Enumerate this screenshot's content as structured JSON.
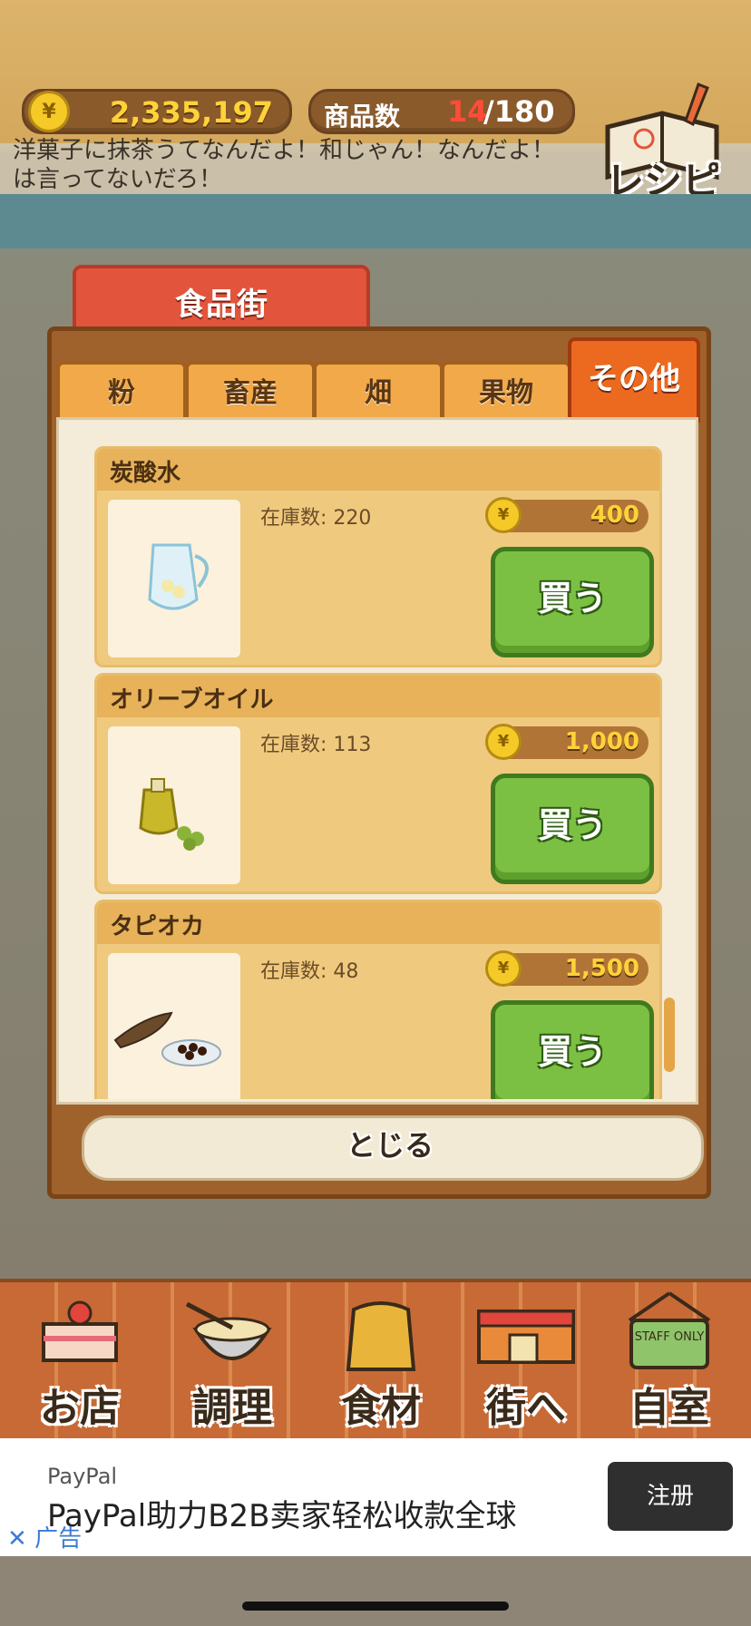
{
  "hud": {
    "coin_icon": "¥",
    "money": "2,335,197",
    "item_count_label": "商品数",
    "item_count_current": "14",
    "item_count_max": "/180",
    "recipe_label": "レシピ"
  },
  "speech": {
    "text": "洋菓子に抹茶うてなんだよ！和じゃん！なんだよ！\nは言ってないだろ！"
  },
  "district": {
    "label": "食品街"
  },
  "tabs": [
    {
      "label": "粉",
      "active": false
    },
    {
      "label": "畜産",
      "active": false
    },
    {
      "label": "畑",
      "active": false
    },
    {
      "label": "果物",
      "active": false
    },
    {
      "label": "その他",
      "active": true
    }
  ],
  "products": [
    {
      "name": "炭酸水",
      "stock": "在庫数: 220",
      "price": "400",
      "buy": "買う",
      "icon": "water-pitcher-icon"
    },
    {
      "name": "オリーブオイル",
      "stock": "在庫数: 113",
      "price": "1,000",
      "buy": "買う",
      "icon": "olive-oil-icon"
    },
    {
      "name": "タピオカ",
      "stock": "在庫数: 48",
      "price": "1,500",
      "buy": "買う",
      "icon": "tapioca-icon"
    }
  ],
  "close_label": "とじる",
  "nav": [
    {
      "label": "お店",
      "icon": "cake-icon"
    },
    {
      "label": "調理",
      "icon": "mixing-bowl-icon"
    },
    {
      "label": "食材",
      "icon": "flour-sack-icon"
    },
    {
      "label": "街へ",
      "icon": "shop-building-icon"
    },
    {
      "label": "自室",
      "icon": "staff-only-sign-icon"
    }
  ],
  "staff_sign": "STAFF ONLY",
  "ad": {
    "brand": "PayPal",
    "title": "PayPal助力B2B卖家轻松收款全球",
    "cta": "注册",
    "tag": "广告",
    "close": "✕"
  },
  "colors": {
    "accent_tab": "#ec6a1f",
    "buy_green": "#7bc043",
    "price_red": "#ff4b3a"
  }
}
